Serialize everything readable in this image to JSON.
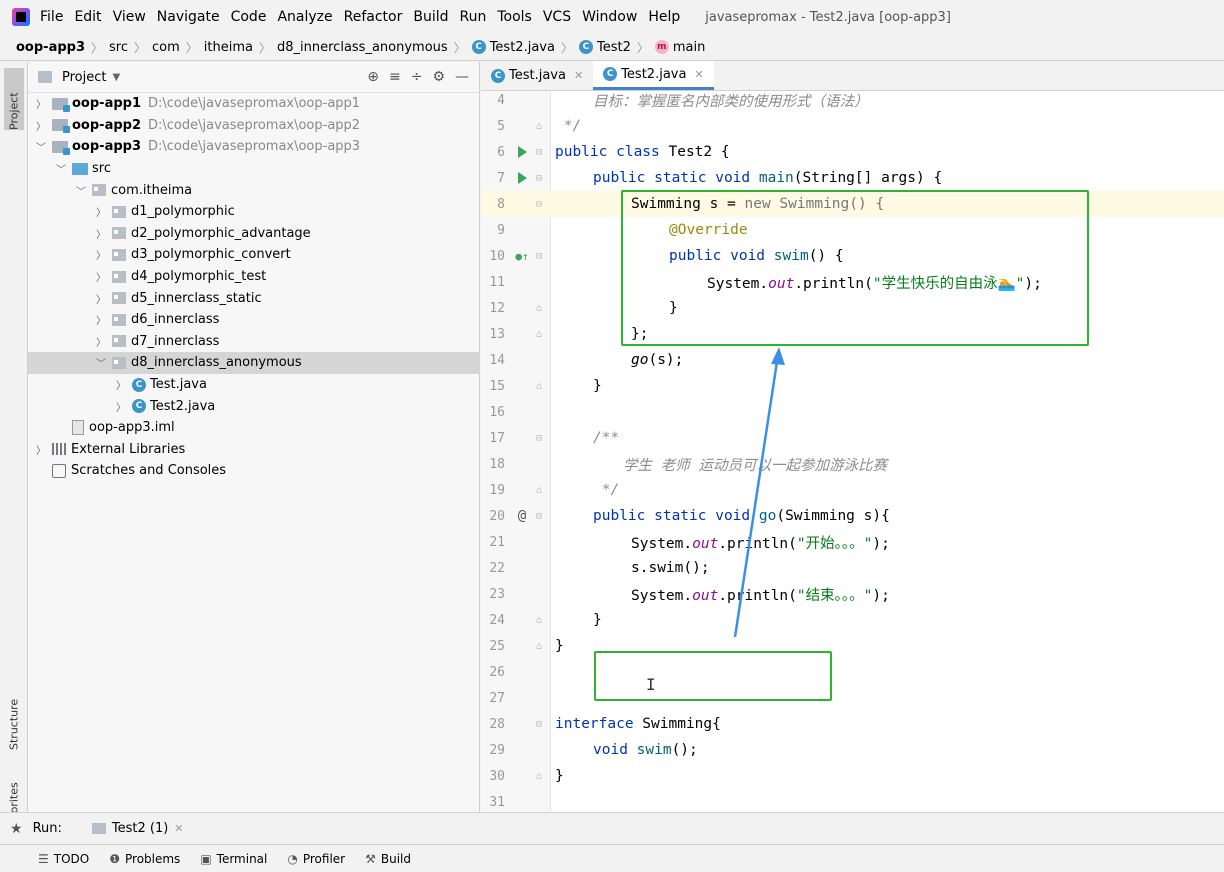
{
  "menu": {
    "items": [
      "File",
      "Edit",
      "View",
      "Navigate",
      "Code",
      "Analyze",
      "Refactor",
      "Build",
      "Run",
      "Tools",
      "VCS",
      "Window",
      "Help"
    ],
    "window_title": "javasepromax - Test2.java [oop-app3]"
  },
  "breadcrumb": {
    "project": "oop-app3",
    "src": "src",
    "com": "com",
    "itheima": "itheima",
    "package": "d8_innerclass_anonymous",
    "file": "Test2.java",
    "class": "Test2",
    "method": "main"
  },
  "left_strip": {
    "project": "Project",
    "structure": "Structure",
    "favorites": "Favorites"
  },
  "project_panel": {
    "title": "Project",
    "tree": [
      {
        "label": "oop-app1",
        "hint": "D:\\code\\javasepromax\\oop-app1"
      },
      {
        "label": "oop-app2",
        "hint": "D:\\code\\javasepromax\\oop-app2"
      },
      {
        "label": "oop-app3",
        "hint": "D:\\code\\javasepromax\\oop-app3"
      },
      {
        "label": "src"
      },
      {
        "label": "com.itheima"
      },
      {
        "label": "d1_polymorphic"
      },
      {
        "label": "d2_polymorphic_advantage"
      },
      {
        "label": "d3_polymorphic_convert"
      },
      {
        "label": "d4_polymorphic_test"
      },
      {
        "label": "d5_innerclass_static"
      },
      {
        "label": "d6_innerclass"
      },
      {
        "label": "d7_innerclass"
      },
      {
        "label": "d8_innerclass_anonymous"
      },
      {
        "label": "Test.java"
      },
      {
        "label": "Test2.java"
      },
      {
        "label": "oop-app3.iml"
      },
      {
        "label": "External Libraries"
      },
      {
        "label": "Scratches and Consoles"
      }
    ]
  },
  "editor": {
    "tabs": [
      {
        "label": "Test.java"
      },
      {
        "label": "Test2.java"
      }
    ],
    "line_numbers": [
      "4",
      "5",
      "6",
      "7",
      "8",
      "9",
      "10",
      "11",
      "12",
      "13",
      "14",
      "15",
      "16",
      "17",
      "18",
      "19",
      "20",
      "21",
      "22",
      "23",
      "24",
      "25",
      "26",
      "27",
      "28",
      "29",
      "30",
      "31"
    ],
    "code": {
      "l4": "目标：掌握匿名内部类的使用形式（语法）",
      "l5": " */",
      "l6_kw": "public class",
      "l6_rest": " Test2 {",
      "l7_kw": "public static void",
      "l7_m": " main",
      "l7_rest": "(String[] args) {",
      "l8_a": "Swimming s = ",
      "l8_new": "new",
      "l8_b": " Swimming() {",
      "l9": "@Override",
      "l10_kw": "public void",
      "l10_m": " swim",
      "l10_rest": "() {",
      "l11_a": "System.",
      "l11_out": "out",
      "l11_b": ".println(",
      "l11_str": "\"学生快乐的自由泳🏊\"",
      "l11_c": ");",
      "l12": "}",
      "l13": "};",
      "l14_go": "go",
      "l14_rest": "(s);",
      "l15": "}",
      "l17": "/**",
      "l18": "学生 老师 运动员可以一起参加游泳比赛",
      "l19": " */",
      "l20_kw": "public static void",
      "l20_m": " go",
      "l20_rest": "(Swimming s){",
      "l21_a": "System.",
      "l21_out": "out",
      "l21_b": ".println(",
      "l21_str": "\"开始。。。\"",
      "l21_c": ");",
      "l22": "s.swim();",
      "l23_a": "System.",
      "l23_out": "out",
      "l23_b": ".println(",
      "l23_str": "\"结束。。。\"",
      "l23_c": ");",
      "l24": "}",
      "l25": "}",
      "l28_kw": "interface",
      "l28_rest": " Swimming{",
      "l29_kw": "void",
      "l29_m": " swim",
      "l29_rest": "();",
      "l30": "}"
    }
  },
  "run_bar": {
    "label": "Run:",
    "tab": "Test2 (1)"
  },
  "bottom_tools": [
    "TODO",
    "Problems",
    "Terminal",
    "Profiler",
    "Build"
  ],
  "colors": {
    "highlight_box": "#2db52d",
    "arrow": "#3b8fe6",
    "accent": "#4083c9"
  }
}
